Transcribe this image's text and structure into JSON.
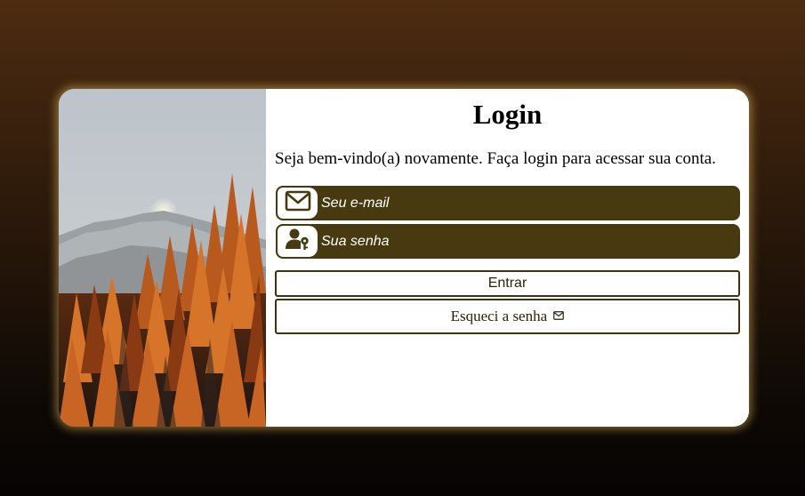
{
  "login": {
    "title": "Login",
    "subtitle": "Seja bem-vindo(a) novamente. Faça login para acessar sua conta.",
    "email_field": {
      "placeholder": "Seu e-mail",
      "icon": "mail-icon"
    },
    "password_field": {
      "placeholder": "Sua senha",
      "icon": "user-key-icon"
    },
    "submit_label": "Entrar",
    "forgot_label": "Esqueci a senha",
    "forgot_icon": "envelope-icon"
  },
  "colors": {
    "accent": "#483a10",
    "border": "#3e3210",
    "glow": "#d6b05a",
    "background_top": "#4d2c11",
    "background_bottom": "#060403"
  }
}
